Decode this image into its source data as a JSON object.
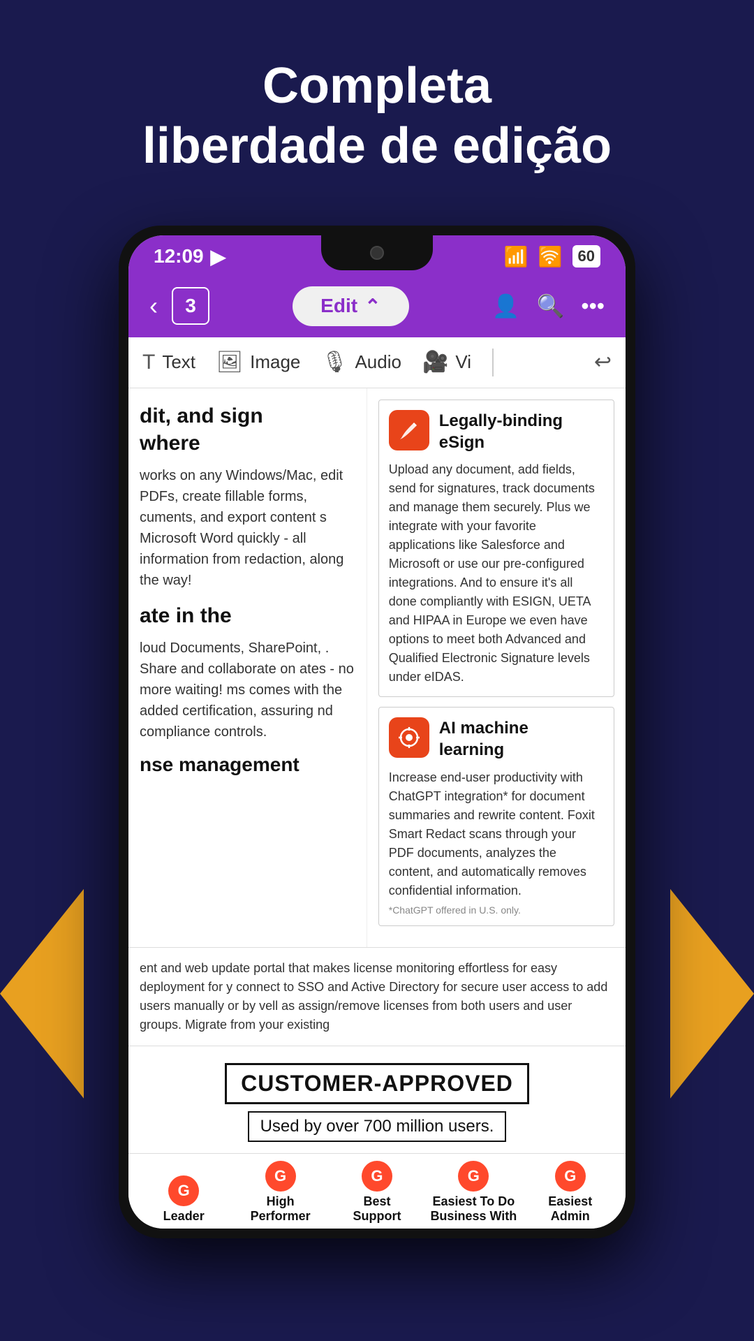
{
  "page": {
    "background": "#1a1a4e",
    "title_line1": "Completa",
    "title_line2": "liberdade de edição"
  },
  "status_bar": {
    "time": "12:09",
    "location_icon": "▶",
    "signal_icon": "📶",
    "wifi_icon": "WiFi",
    "battery": "60"
  },
  "toolbar": {
    "back_icon": "‹",
    "page_number": "3",
    "edit_label": "Edit",
    "edit_arrow": "⌃",
    "add_user_icon": "👤+",
    "search_icon": "🔍",
    "more_icon": "···"
  },
  "edit_bar": {
    "text_icon": "T",
    "text_label": "Text",
    "image_icon": "🖼",
    "image_label": "Image",
    "audio_icon": "🎤",
    "audio_label": "Audio",
    "video_icon": "📹",
    "video_label": "Vi",
    "undo_icon": "↩"
  },
  "doc_left": {
    "heading1": "dit, and sign\nwhere",
    "text1": "works on any Windows/Mac,\nedit PDFs, create fillable forms,\ncuments, and export content\ns Microsoft Word quickly - all\ninformation from\nredaction, along the way!",
    "heading2": "ate in the",
    "text2": "loud Documents, SharePoint,\n. Share and collaborate on\nates - no more waiting!\nms comes with the added\ncertification, assuring\nnd compliance controls.",
    "heading3": "nse management",
    "text3": "ent and web update portal that makes license monitoring effortless for easy deployment for\ny connect to SSO and Active Directory for secure user access to add users manually or by\nvell as assign/remove licenses from both users and user groups. Migrate from your existing"
  },
  "doc_right": {
    "feature1": {
      "icon": "✍",
      "title": "Legally-binding\neSign",
      "description": "Upload any document, add fields, send for signatures, track documents and manage them securely. Plus we integrate with your favorite applications like Salesforce and Microsoft or use our pre-configured integrations. And to ensure it's all done compliantly with ESIGN, UETA and HIPAA in Europe we even have options to meet both Advanced and Qualified Electronic Signature levels under eIDAS."
    },
    "feature2": {
      "icon": "🤖",
      "title": "AI machine\nlearning",
      "description": "Increase end-user productivity with ChatGPT integration* for document summaries and rewrite content. Foxit Smart Redact scans through your PDF documents, analyzes the content, and automatically removes confidential information.",
      "footnote": "*ChatGPT offered in U.S. only."
    }
  },
  "customer_section": {
    "approved_label": "CUSTOMER-APPROVED",
    "used_by": "Used by over 700 million users."
  },
  "badges": [
    {
      "label": "Leader",
      "sublabel": ""
    },
    {
      "label": "High\nPerformer",
      "sublabel": ""
    },
    {
      "label": "Best\nSupport",
      "sublabel": ""
    },
    {
      "label": "Easiest To Do\nBusiness With",
      "sublabel": ""
    },
    {
      "label": "Easiest\nAdmin",
      "sublabel": ""
    }
  ]
}
